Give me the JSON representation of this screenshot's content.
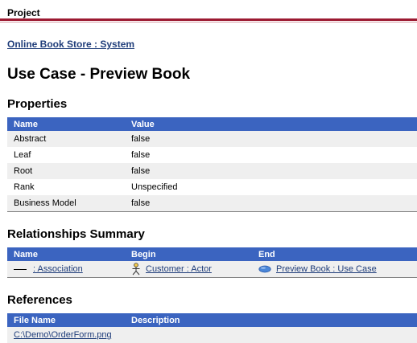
{
  "header": {
    "label": "Project",
    "system_link": "Online Book Store : System"
  },
  "page": {
    "title": "Use Case - Preview Book"
  },
  "properties": {
    "title": "Properties",
    "columns": [
      "Name",
      "Value"
    ],
    "rows": [
      {
        "name": "Abstract",
        "value": "false"
      },
      {
        "name": "Leaf",
        "value": "false"
      },
      {
        "name": "Root",
        "value": "false"
      },
      {
        "name": "Rank",
        "value": "Unspecified"
      },
      {
        "name": "Business Model",
        "value": "false"
      }
    ]
  },
  "relationships": {
    "title": "Relationships Summary",
    "columns": [
      "Name",
      "Begin",
      "End"
    ],
    "rows": [
      {
        "name": ": Association",
        "begin": "Customer : Actor",
        "end": "Preview Book : Use Case"
      }
    ]
  },
  "references": {
    "title": "References",
    "columns": [
      "File Name",
      "Description"
    ],
    "rows": [
      {
        "file": "C:\\Demo\\OrderForm.png",
        "description": ""
      }
    ]
  },
  "icons": {
    "association": "association-line-icon",
    "actor": "actor-icon",
    "use_case": "use-case-icon"
  },
  "colors": {
    "header_rule": "#9c1a32",
    "table_header": "#3b64c0",
    "link": "#1f3d7a",
    "row_alt": "#efefef"
  }
}
